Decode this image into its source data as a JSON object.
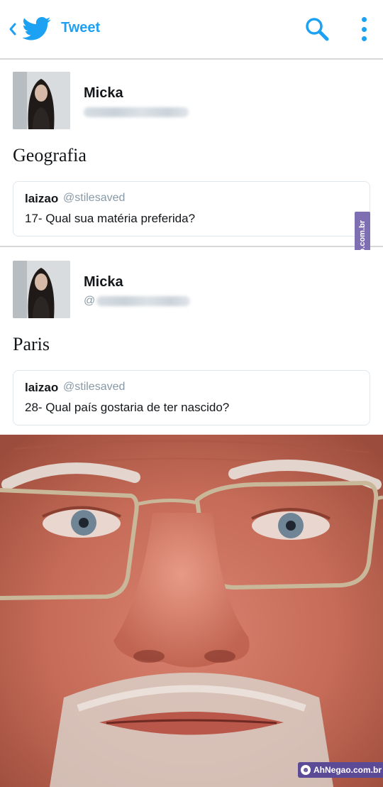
{
  "header": {
    "title": "Tweet",
    "back_icon": "chevron-left-icon",
    "logo_icon": "twitter-bird-icon",
    "search_icon": "search-icon",
    "more_icon": "more-vertical-icon",
    "accent_color": "#1da1f2"
  },
  "tweets": [
    {
      "author_name": "Micka",
      "author_handle": "",
      "text": "Geografia",
      "quoted": {
        "name": "laizao",
        "handle": "@stilesaved",
        "text": "17- Qual sua matéria preferida?"
      }
    },
    {
      "author_name": "Micka",
      "author_handle": "@",
      "text": "Paris",
      "quoted": {
        "name": "laizao",
        "handle": "@stilesaved",
        "text": "28- Qual país gostaria de ter nascido?"
      }
    }
  ],
  "watermarks": {
    "side": "AhNegao.com.br",
    "bottom": "AhNegao.com.br",
    "color": "#5b4b97"
  }
}
